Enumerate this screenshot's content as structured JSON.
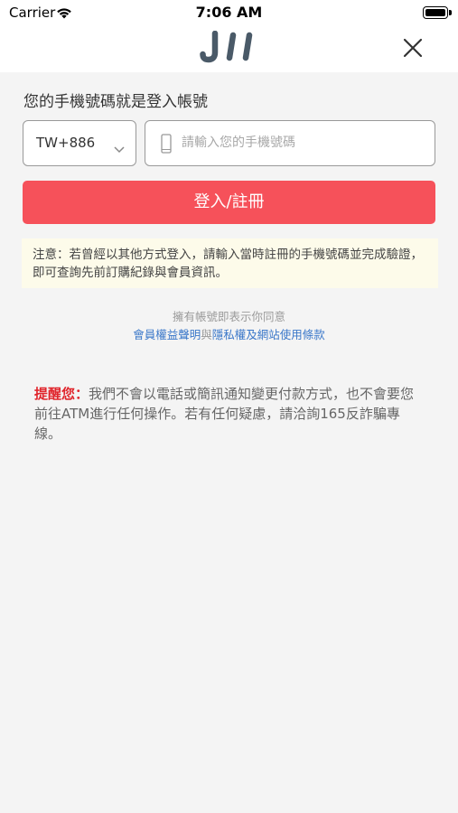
{
  "status_bar": {
    "carrier": "Carrier",
    "time": "7:06 AM",
    "wifi_icon": "wifi-icon",
    "battery_icon": "battery-icon"
  },
  "header": {
    "logo_icon": "jii-logo",
    "logo_text": "JII",
    "close_icon": "close-icon"
  },
  "form": {
    "prompt": "您的手機號碼就是登入帳號",
    "country_code": "TW+886",
    "phone_placeholder": "請輸入您的手機號碼",
    "submit_label": "登入/註冊"
  },
  "notice": {
    "text": "注意：若曾經以其他方式登入，請輸入當時註冊的手機號碼並完成驗證，即可查詢先前訂購紀錄與會員資訊。"
  },
  "agreement": {
    "line1": "擁有帳號即表示你同意",
    "link1": "會員權益聲明",
    "conjunction": "與",
    "link2": "隱私權及網站使用條款"
  },
  "reminder": {
    "label": "提醒您：",
    "text": "我們不會以電話或簡訊通知變更付款方式，也不會要您前往ATM進行任何操作。若有任何疑慮，請洽詢165反詐騙專線。"
  },
  "colors": {
    "primary": "#f6515a",
    "link": "#3a77c9",
    "warning": "#e0252c",
    "notice_bg": "#fdfbea",
    "logo": "#4a5a68"
  }
}
